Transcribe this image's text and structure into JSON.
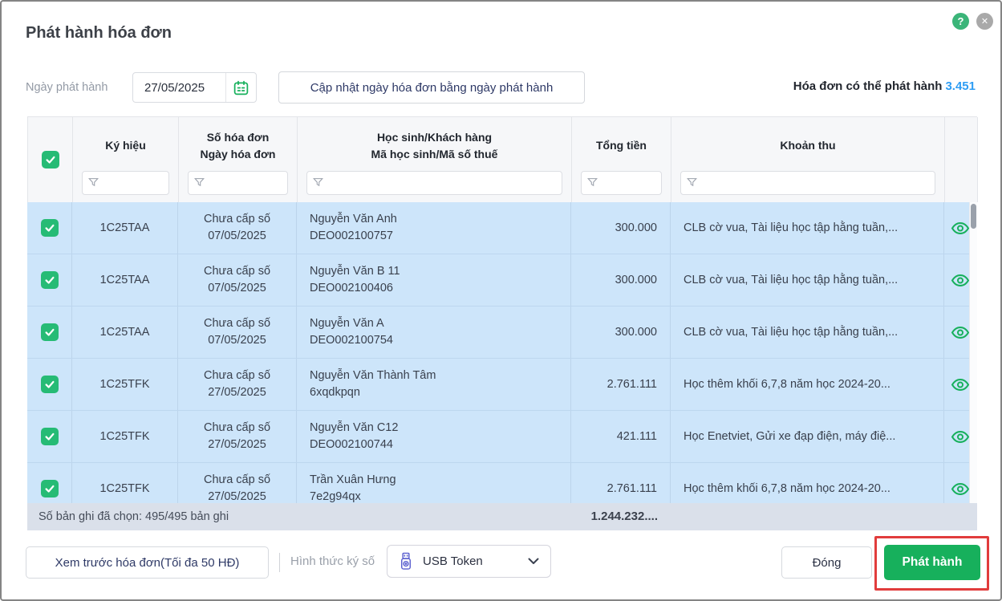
{
  "dialog": {
    "title": "Phát hành hóa đơn",
    "issue_date_label": "Ngày phát hành",
    "issue_date_value": "27/05/2025",
    "update_button_label": "Cập nhật ngày hóa đơn bằng ngày phát hành",
    "available_label": "Hóa đơn có thể phát hành",
    "available_count": "3.451"
  },
  "icons": {
    "help_glyph": "?",
    "close_glyph": "✕",
    "names": [
      "help-icon",
      "close-icon",
      "calendar-icon",
      "funnel-icon",
      "checkmark-icon",
      "eye-icon",
      "usb-token-icon",
      "chevron-down-icon"
    ]
  },
  "table": {
    "headers": [
      {
        "line1": "Ký hiệu",
        "line2": ""
      },
      {
        "line1": "Số hóa đơn",
        "line2": "Ngày hóa đơn"
      },
      {
        "line1": "Học sinh/Khách hàng",
        "line2": "Mã học sinh/Mã số thuế"
      },
      {
        "line1": "Tổng tiền",
        "line2": ""
      },
      {
        "line1": "Khoản thu",
        "line2": ""
      }
    ],
    "rows": [
      {
        "checked": true,
        "symbol": "1C25TAA",
        "invoice_status": "Chưa cấp số",
        "invoice_date": "07/05/2025",
        "customer_name": "Nguyễn Văn Anh",
        "customer_code": "DEO002100757",
        "total": "300.000",
        "fees": "CLB cờ vua, Tài liệu học tập hằng tuần,..."
      },
      {
        "checked": true,
        "symbol": "1C25TAA",
        "invoice_status": "Chưa cấp số",
        "invoice_date": "07/05/2025",
        "customer_name": "Nguyễn Văn B 11",
        "customer_code": "DEO002100406",
        "total": "300.000",
        "fees": "CLB cờ vua, Tài liệu học tập hằng tuần,..."
      },
      {
        "checked": true,
        "symbol": "1C25TAA",
        "invoice_status": "Chưa cấp số",
        "invoice_date": "07/05/2025",
        "customer_name": "Nguyễn Văn A",
        "customer_code": "DEO002100754",
        "total": "300.000",
        "fees": "CLB cờ vua, Tài liệu học tập hằng tuần,..."
      },
      {
        "checked": true,
        "symbol": "1C25TFK",
        "invoice_status": "Chưa cấp số",
        "invoice_date": "27/05/2025",
        "customer_name": "Nguyễn Văn Thành Tâm",
        "customer_code": "6xqdkpqn",
        "total": "2.761.111",
        "fees": "Học thêm khối 6,7,8 năm học 2024-20..."
      },
      {
        "checked": true,
        "symbol": "1C25TFK",
        "invoice_status": "Chưa cấp số",
        "invoice_date": "27/05/2025",
        "customer_name": "Nguyễn Văn C12",
        "customer_code": "DEO002100744",
        "total": "421.111",
        "fees": "Học Enetviet, Gửi xe đạp điện, máy điệ..."
      },
      {
        "checked": true,
        "symbol": "1C25TFK",
        "invoice_status": "Chưa cấp số",
        "invoice_date": "27/05/2025",
        "customer_name": "Trần Xuân Hưng",
        "customer_code": "7e2g94qx",
        "total": "2.761.111",
        "fees": "Học thêm khối 6,7,8 năm học 2024-20..."
      }
    ]
  },
  "summary": {
    "selected_text": "Số bản ghi đã chọn: 495/495 bản ghi",
    "total_amount": "1.244.232...."
  },
  "footer": {
    "preview_button": "Xem trước hóa đơn(Tối đa 50 HĐ)",
    "sign_method_label": "Hình thức ký số",
    "sign_method_value": "USB Token",
    "close_button": "Đóng",
    "issue_button": "Phát hành"
  },
  "colors": {
    "accent_green": "#17b05c",
    "checkbox_green": "#26bb75",
    "row_blue": "#cde5fa",
    "count_blue": "#2e9df4",
    "annotation_red": "#e13c3c",
    "navy_text": "#2e3966",
    "usb_icon_purple": "#5a5fcf"
  }
}
